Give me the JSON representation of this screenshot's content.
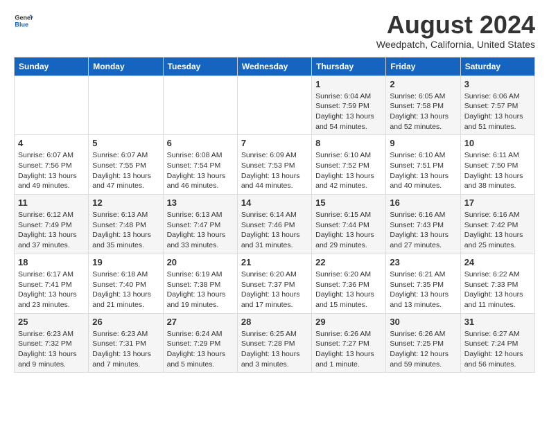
{
  "header": {
    "logo_general": "General",
    "logo_blue": "Blue",
    "title": "August 2024",
    "subtitle": "Weedpatch, California, United States"
  },
  "calendar": {
    "weekdays": [
      "Sunday",
      "Monday",
      "Tuesday",
      "Wednesday",
      "Thursday",
      "Friday",
      "Saturday"
    ],
    "weeks": [
      [
        {
          "day": "",
          "info": ""
        },
        {
          "day": "",
          "info": ""
        },
        {
          "day": "",
          "info": ""
        },
        {
          "day": "",
          "info": ""
        },
        {
          "day": "1",
          "info": "Sunrise: 6:04 AM\nSunset: 7:59 PM\nDaylight: 13 hours\nand 54 minutes."
        },
        {
          "day": "2",
          "info": "Sunrise: 6:05 AM\nSunset: 7:58 PM\nDaylight: 13 hours\nand 52 minutes."
        },
        {
          "day": "3",
          "info": "Sunrise: 6:06 AM\nSunset: 7:57 PM\nDaylight: 13 hours\nand 51 minutes."
        }
      ],
      [
        {
          "day": "4",
          "info": "Sunrise: 6:07 AM\nSunset: 7:56 PM\nDaylight: 13 hours\nand 49 minutes."
        },
        {
          "day": "5",
          "info": "Sunrise: 6:07 AM\nSunset: 7:55 PM\nDaylight: 13 hours\nand 47 minutes."
        },
        {
          "day": "6",
          "info": "Sunrise: 6:08 AM\nSunset: 7:54 PM\nDaylight: 13 hours\nand 46 minutes."
        },
        {
          "day": "7",
          "info": "Sunrise: 6:09 AM\nSunset: 7:53 PM\nDaylight: 13 hours\nand 44 minutes."
        },
        {
          "day": "8",
          "info": "Sunrise: 6:10 AM\nSunset: 7:52 PM\nDaylight: 13 hours\nand 42 minutes."
        },
        {
          "day": "9",
          "info": "Sunrise: 6:10 AM\nSunset: 7:51 PM\nDaylight: 13 hours\nand 40 minutes."
        },
        {
          "day": "10",
          "info": "Sunrise: 6:11 AM\nSunset: 7:50 PM\nDaylight: 13 hours\nand 38 minutes."
        }
      ],
      [
        {
          "day": "11",
          "info": "Sunrise: 6:12 AM\nSunset: 7:49 PM\nDaylight: 13 hours\nand 37 minutes."
        },
        {
          "day": "12",
          "info": "Sunrise: 6:13 AM\nSunset: 7:48 PM\nDaylight: 13 hours\nand 35 minutes."
        },
        {
          "day": "13",
          "info": "Sunrise: 6:13 AM\nSunset: 7:47 PM\nDaylight: 13 hours\nand 33 minutes."
        },
        {
          "day": "14",
          "info": "Sunrise: 6:14 AM\nSunset: 7:46 PM\nDaylight: 13 hours\nand 31 minutes."
        },
        {
          "day": "15",
          "info": "Sunrise: 6:15 AM\nSunset: 7:44 PM\nDaylight: 13 hours\nand 29 minutes."
        },
        {
          "day": "16",
          "info": "Sunrise: 6:16 AM\nSunset: 7:43 PM\nDaylight: 13 hours\nand 27 minutes."
        },
        {
          "day": "17",
          "info": "Sunrise: 6:16 AM\nSunset: 7:42 PM\nDaylight: 13 hours\nand 25 minutes."
        }
      ],
      [
        {
          "day": "18",
          "info": "Sunrise: 6:17 AM\nSunset: 7:41 PM\nDaylight: 13 hours\nand 23 minutes."
        },
        {
          "day": "19",
          "info": "Sunrise: 6:18 AM\nSunset: 7:40 PM\nDaylight: 13 hours\nand 21 minutes."
        },
        {
          "day": "20",
          "info": "Sunrise: 6:19 AM\nSunset: 7:38 PM\nDaylight: 13 hours\nand 19 minutes."
        },
        {
          "day": "21",
          "info": "Sunrise: 6:20 AM\nSunset: 7:37 PM\nDaylight: 13 hours\nand 17 minutes."
        },
        {
          "day": "22",
          "info": "Sunrise: 6:20 AM\nSunset: 7:36 PM\nDaylight: 13 hours\nand 15 minutes."
        },
        {
          "day": "23",
          "info": "Sunrise: 6:21 AM\nSunset: 7:35 PM\nDaylight: 13 hours\nand 13 minutes."
        },
        {
          "day": "24",
          "info": "Sunrise: 6:22 AM\nSunset: 7:33 PM\nDaylight: 13 hours\nand 11 minutes."
        }
      ],
      [
        {
          "day": "25",
          "info": "Sunrise: 6:23 AM\nSunset: 7:32 PM\nDaylight: 13 hours\nand 9 minutes."
        },
        {
          "day": "26",
          "info": "Sunrise: 6:23 AM\nSunset: 7:31 PM\nDaylight: 13 hours\nand 7 minutes."
        },
        {
          "day": "27",
          "info": "Sunrise: 6:24 AM\nSunset: 7:29 PM\nDaylight: 13 hours\nand 5 minutes."
        },
        {
          "day": "28",
          "info": "Sunrise: 6:25 AM\nSunset: 7:28 PM\nDaylight: 13 hours\nand 3 minutes."
        },
        {
          "day": "29",
          "info": "Sunrise: 6:26 AM\nSunset: 7:27 PM\nDaylight: 13 hours\nand 1 minute."
        },
        {
          "day": "30",
          "info": "Sunrise: 6:26 AM\nSunset: 7:25 PM\nDaylight: 12 hours\nand 59 minutes."
        },
        {
          "day": "31",
          "info": "Sunrise: 6:27 AM\nSunset: 7:24 PM\nDaylight: 12 hours\nand 56 minutes."
        }
      ]
    ]
  }
}
